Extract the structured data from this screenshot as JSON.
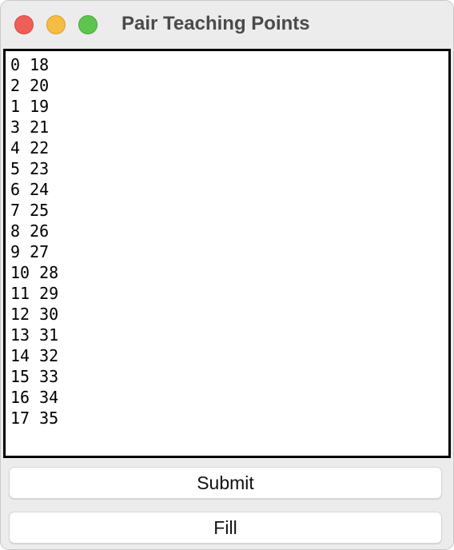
{
  "window": {
    "title": "Pair Teaching Points"
  },
  "textarea": {
    "lines": [
      "0 18",
      "2 20",
      "1 19",
      "3 21",
      "4 22",
      "5 23",
      "6 24",
      "7 25",
      "8 26",
      "9 27",
      "10 28",
      "11 29",
      "12 30",
      "13 31",
      "14 32",
      "15 33",
      "16 34",
      "17 35"
    ]
  },
  "buttons": {
    "submit_label": "Submit",
    "fill_label": "Fill"
  },
  "colors": {
    "close": "#ee5f58",
    "minimize": "#f5bd44",
    "zoom": "#5fc350"
  }
}
